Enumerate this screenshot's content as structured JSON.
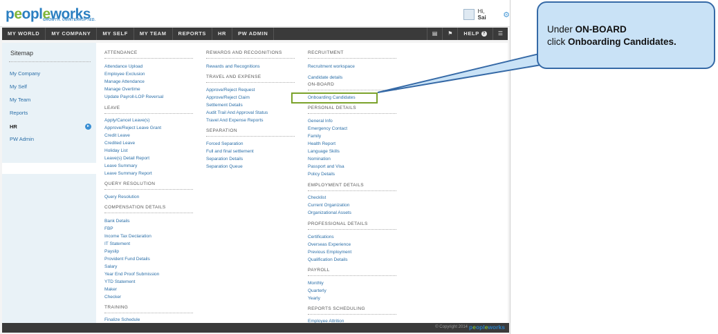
{
  "header": {
    "logo_text": "peopleworks",
    "tagline": "GROWTH. UNINTERRUPTED.",
    "greeting": "Hi,",
    "user_name": "Sai"
  },
  "nav": {
    "items": [
      "MY WORLD",
      "MY COMPANY",
      "MY SELF",
      "MY TEAM",
      "REPORTS",
      "HR",
      "PW ADMIN"
    ],
    "help_label": "HELP"
  },
  "sitemap": {
    "title": "Sitemap",
    "items": [
      "My Company",
      "My Self",
      "My Team",
      "Reports",
      "HR",
      "PW Admin"
    ],
    "active": "HR"
  },
  "columns": {
    "col1": {
      "attendance": {
        "title": "ATTENDANCE",
        "links": [
          "Attendance Upload",
          "Employee Exclusion",
          "Manage Attendance",
          "Manage Overtime",
          "Update Payroll-LOP Reversal"
        ]
      },
      "leave": {
        "title": "LEAVE",
        "links": [
          "Apply/Cancel Leave(s)",
          "Approve/Reject Leave Grant",
          "Credit Leave",
          "Credited Leave",
          "Holiday List",
          "Leave(s) Detail Report",
          "Leave Summary",
          "Leave Summary Report"
        ]
      },
      "query": {
        "title": "QUERY RESOLUTION",
        "links": [
          "Query Resolution"
        ]
      },
      "compensation": {
        "title": "COMPENSATION DETAILS",
        "links": [
          "Bank Details",
          "FBP",
          "Income Tax Declaration",
          "IT Statement",
          "Payslip",
          "Provident Fund Details",
          "Salary",
          "Year End Proof Submission",
          "YTD Statement",
          "Maker",
          "Checker"
        ]
      },
      "training": {
        "title": "TRAINING",
        "links": [
          "Finalize Schedule"
        ]
      }
    },
    "col2": {
      "rewards": {
        "title": "REWARDS AND RECOGNITIONS",
        "links": [
          "Rewards and Recognitions"
        ]
      },
      "travel": {
        "title": "TRAVEL AND EXPENSE",
        "links": [
          "Approve/Reject Request",
          "Approve/Reject Claim",
          "Settlement Details",
          "Audit Trail And Approval Status",
          "Travel And Expense Reports"
        ]
      },
      "separation": {
        "title": "SEPARATION",
        "links": [
          "Forced Separation",
          "Full and final settlement",
          "Separation Details",
          "Separation Queue"
        ]
      }
    },
    "col3": {
      "recruitment": {
        "title": "RECRUITMENT",
        "links": [
          "Recruitment workspace",
          "Candidate details"
        ]
      },
      "onboard": {
        "title": "ON-BOARD",
        "links": [
          "Onboarding Candidates"
        ]
      },
      "personal": {
        "title": "PERSONAL DETAILS",
        "links": [
          "General Info",
          "Emergency Contact",
          "Family",
          "Health Report",
          "Language Skills",
          "Nomination",
          "Passport and Visa",
          "Policy Details"
        ]
      },
      "employment": {
        "title": "EMPLOYMENT DETAILS",
        "links": [
          "Checklist",
          "Current Organization",
          "Organizational Assets"
        ]
      },
      "professional": {
        "title": "PROFESSIONAL DETAILS",
        "links": [
          "Certifications",
          "Overseas Experience",
          "Previous Employment",
          "Qualification Details"
        ]
      },
      "payroll": {
        "title": "PAYROLL",
        "links": [
          "Monthly",
          "Quarterly",
          "Yearly"
        ]
      },
      "reports": {
        "title": "REPORTS SCHEDULING",
        "links": [
          "Employee Attrition"
        ]
      }
    }
  },
  "footer": {
    "copyright": "© Copyright 2014",
    "logo_text": "peopleworks"
  },
  "callout": {
    "line1_prefix": "Under ",
    "line1_bold": "ON-BOARD",
    "line2_prefix": "click ",
    "line2_bold": "Onboarding Candidates."
  },
  "colors": {
    "accent": "#2b7fc1",
    "brand_green": "#7fb539",
    "nav_bg": "#3a3a3a",
    "link": "#2b6fa8",
    "highlight": "#7aa22a",
    "callout_fill": "#c9e2f6",
    "callout_border": "#3569a6"
  }
}
